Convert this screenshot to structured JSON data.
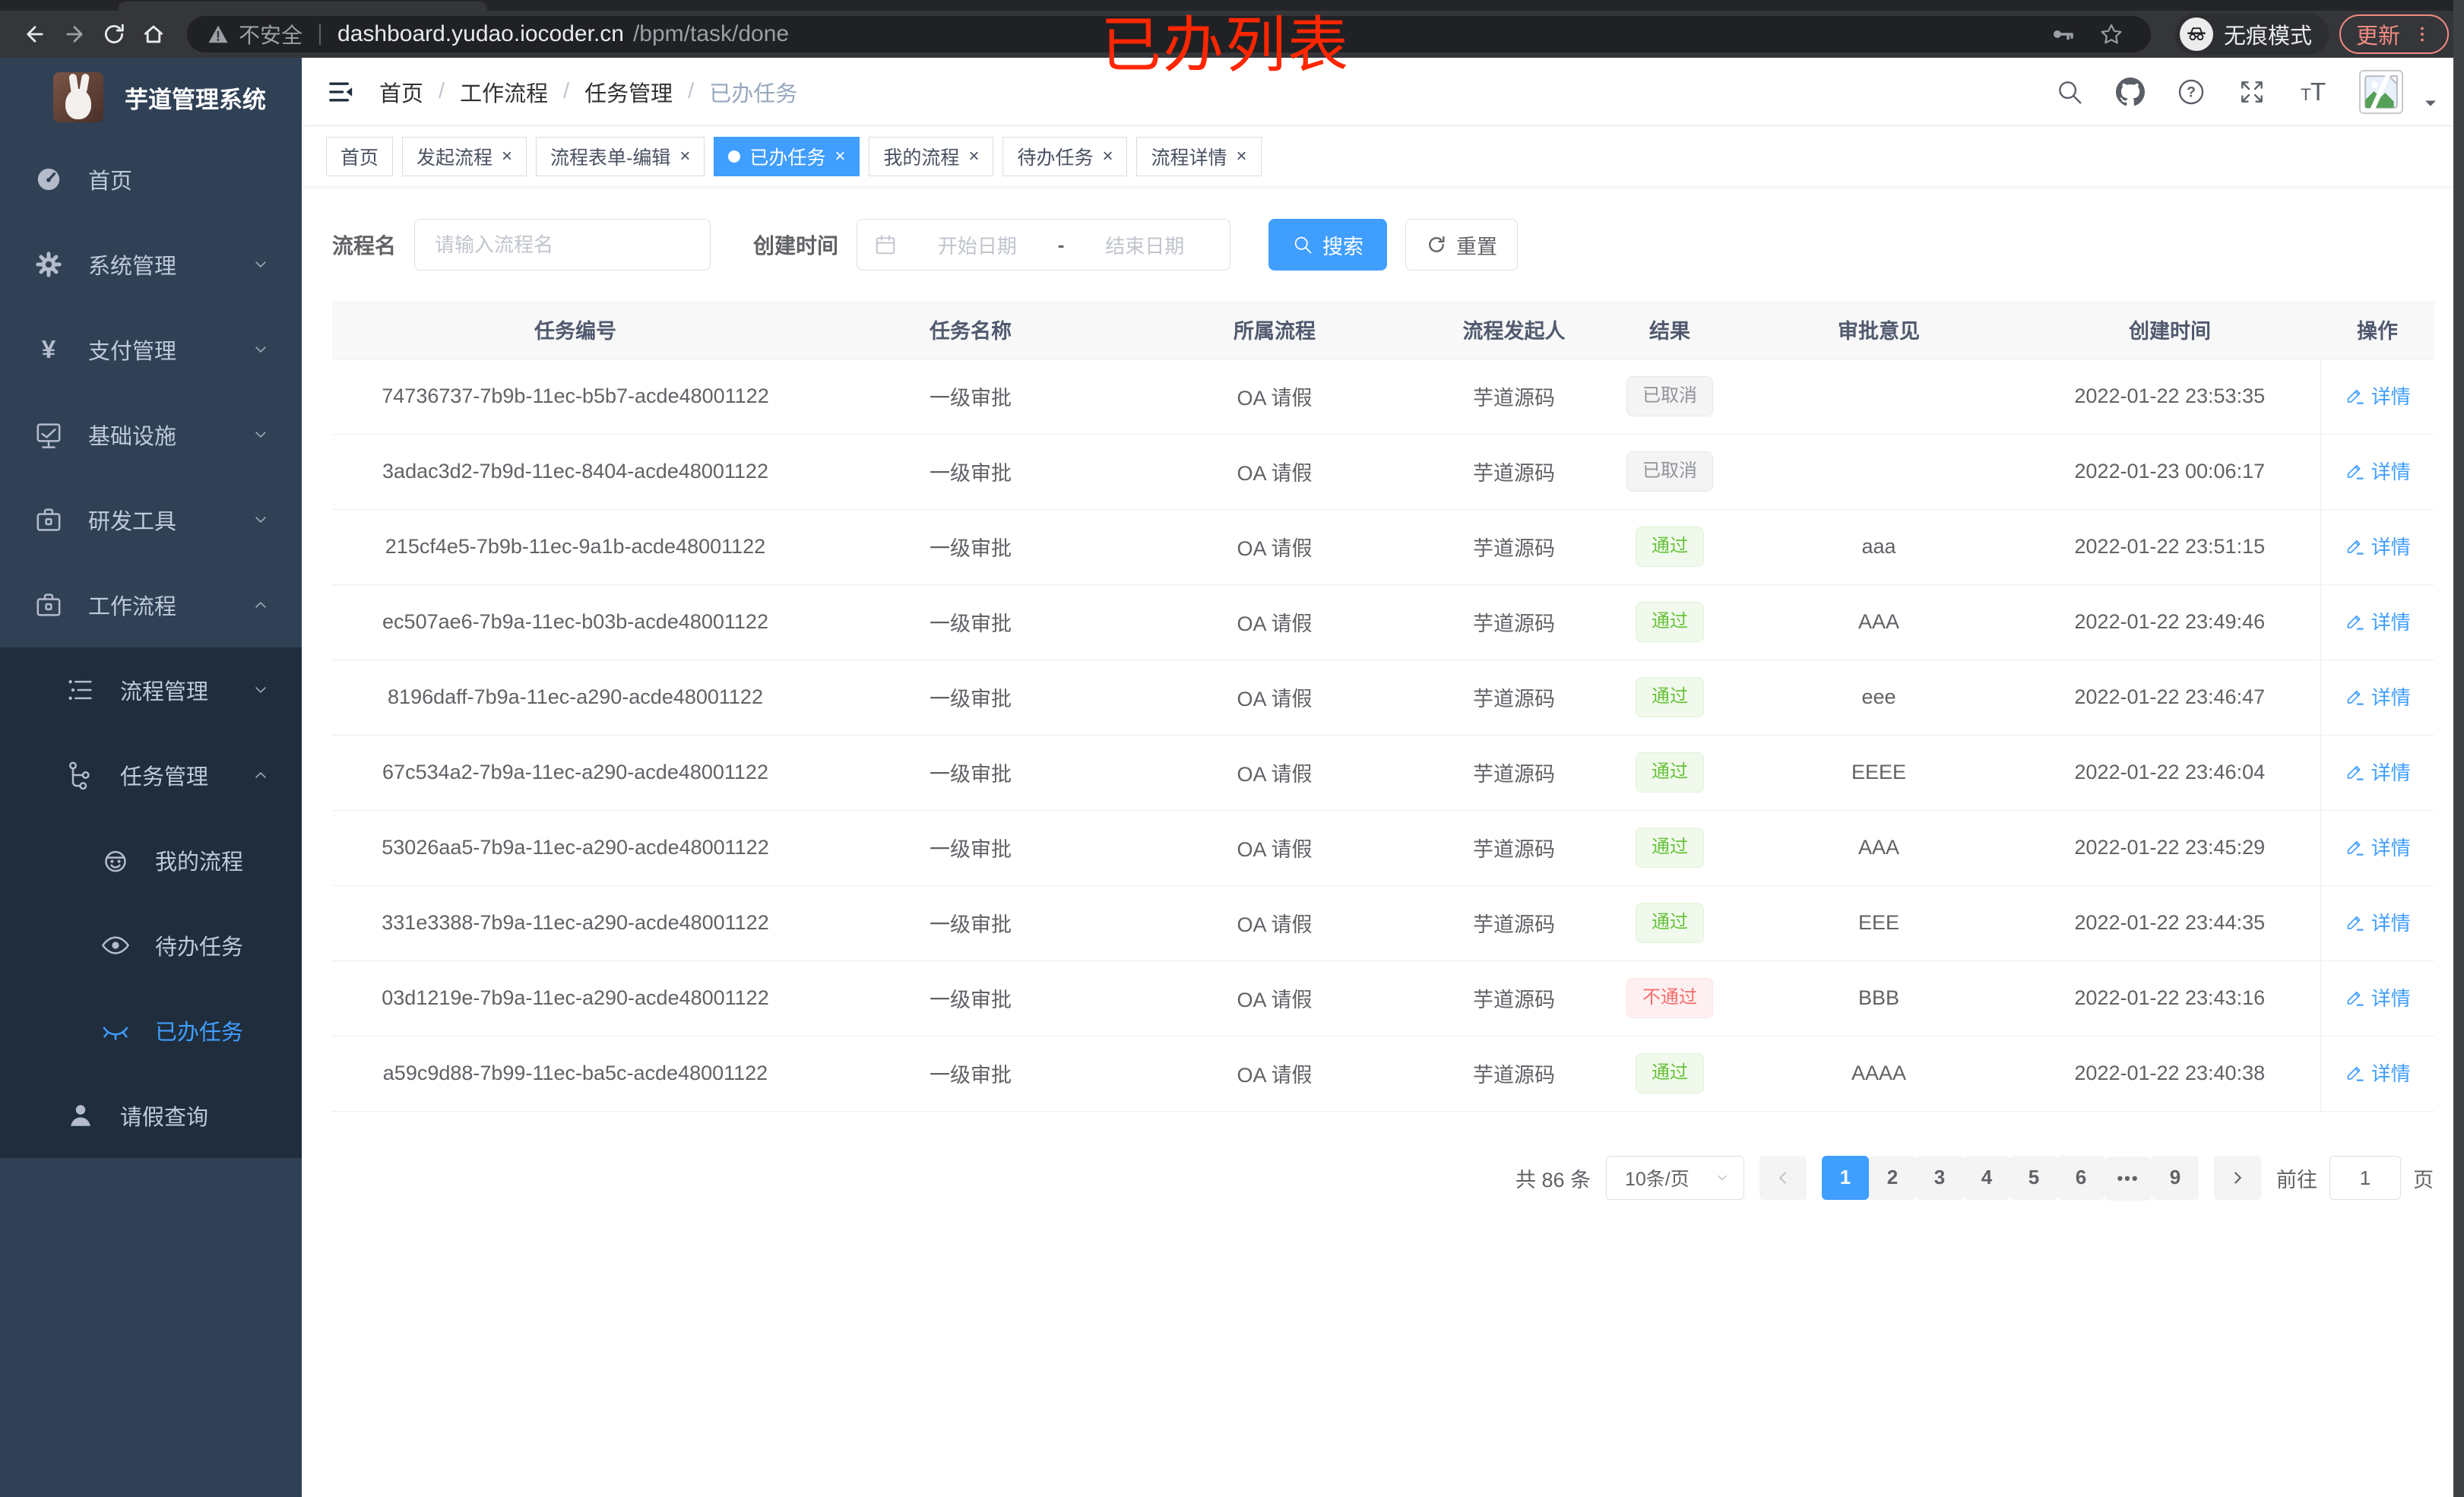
{
  "browser": {
    "security": "不安全",
    "url_host": "dashboard.yudao.iocoder.cn",
    "url_path": "/bpm/task/done",
    "incognito_label": "无痕模式",
    "update_label": "更新"
  },
  "annotation": {
    "text": "已办列表",
    "color": "#ff2600"
  },
  "sidebar": {
    "title": "芋道管理系统",
    "items": [
      {
        "label": "首页",
        "icon": "dashboard",
        "cls": "lv1",
        "chevron": ""
      },
      {
        "label": "系统管理",
        "icon": "gear",
        "cls": "lv1",
        "chevron": "down"
      },
      {
        "label": "支付管理",
        "icon": "yen",
        "cls": "lv1",
        "chevron": "down"
      },
      {
        "label": "基础设施",
        "icon": "infra",
        "cls": "lv1",
        "chevron": "down"
      },
      {
        "label": "研发工具",
        "icon": "briefcase",
        "cls": "lv1",
        "chevron": "down"
      },
      {
        "label": "工作流程",
        "icon": "briefcase",
        "cls": "lv1",
        "chevron": "up"
      },
      {
        "label": "流程管理",
        "icon": "tree-list",
        "cls": "lv2 sub",
        "chevron": "down"
      },
      {
        "label": "任务管理",
        "icon": "flow-nodes",
        "cls": "lv2 sub",
        "chevron": "up"
      },
      {
        "label": "我的流程",
        "icon": "robot",
        "cls": "lv3 sub",
        "chevron": ""
      },
      {
        "label": "待办任务",
        "icon": "eye-open",
        "cls": "lv3 sub",
        "chevron": ""
      },
      {
        "label": "已办任务",
        "icon": "eye-closed",
        "cls": "lv3 sub active",
        "chevron": ""
      },
      {
        "label": "请假查询",
        "icon": "user",
        "cls": "lv2 sub",
        "chevron": ""
      }
    ]
  },
  "header": {
    "breadcrumb": [
      {
        "label": "首页",
        "sep": "/"
      },
      {
        "label": "工作流程",
        "sep": "/"
      },
      {
        "label": "任务管理",
        "sep": "/"
      },
      {
        "label": "已办任务",
        "cls": "last"
      }
    ]
  },
  "tagsview": {
    "tabs": [
      {
        "label": "首页"
      },
      {
        "label": "发起流程",
        "closable": true
      },
      {
        "label": "流程表单-编辑",
        "closable": true
      },
      {
        "label": "已办任务",
        "closable": true,
        "cls": "active"
      },
      {
        "label": "我的流程",
        "closable": true
      },
      {
        "label": "待办任务",
        "closable": true
      },
      {
        "label": "流程详情",
        "closable": true
      }
    ]
  },
  "filters": {
    "name_label": "流程名",
    "name_placeholder": "请输入流程名",
    "time_label": "创建时间",
    "start_placeholder": "开始日期",
    "range_separator": "-",
    "end_placeholder": "结束日期",
    "search_label": "搜索",
    "reset_label": "重置"
  },
  "table": {
    "headers": [
      {
        "label": "任务编号"
      },
      {
        "label": "任务名称"
      },
      {
        "label": "所属流程"
      },
      {
        "label": "流程发起人"
      },
      {
        "label": "结果"
      },
      {
        "label": "审批意见"
      },
      {
        "label": "创建时间"
      },
      {
        "label": "操作"
      }
    ],
    "action_label": "详情",
    "rows": [
      {
        "id": "74736737-7b9b-11ec-b5b7-acde48001122",
        "name": "一级审批",
        "process": "OA 请假",
        "starter": "芋道源码",
        "result": "已取消",
        "resultCls": "tag-info",
        "comment": "",
        "created": "2022-01-22 23:53:35"
      },
      {
        "id": "3adac3d2-7b9d-11ec-8404-acde48001122",
        "name": "一级审批",
        "process": "OA 请假",
        "starter": "芋道源码",
        "result": "已取消",
        "resultCls": "tag-info",
        "comment": "",
        "created": "2022-01-23 00:06:17"
      },
      {
        "id": "215cf4e5-7b9b-11ec-9a1b-acde48001122",
        "name": "一级审批",
        "process": "OA 请假",
        "starter": "芋道源码",
        "result": "通过",
        "resultCls": "tag-success",
        "comment": "aaa",
        "created": "2022-01-22 23:51:15"
      },
      {
        "id": "ec507ae6-7b9a-11ec-b03b-acde48001122",
        "name": "一级审批",
        "process": "OA 请假",
        "starter": "芋道源码",
        "result": "通过",
        "resultCls": "tag-success",
        "comment": "AAA",
        "created": "2022-01-22 23:49:46"
      },
      {
        "id": "8196daff-7b9a-11ec-a290-acde48001122",
        "name": "一级审批",
        "process": "OA 请假",
        "starter": "芋道源码",
        "result": "通过",
        "resultCls": "tag-success",
        "comment": "eee",
        "created": "2022-01-22 23:46:47"
      },
      {
        "id": "67c534a2-7b9a-11ec-a290-acde48001122",
        "name": "一级审批",
        "process": "OA 请假",
        "starter": "芋道源码",
        "result": "通过",
        "resultCls": "tag-success",
        "comment": "EEEE",
        "created": "2022-01-22 23:46:04"
      },
      {
        "id": "53026aa5-7b9a-11ec-a290-acde48001122",
        "name": "一级审批",
        "process": "OA 请假",
        "starter": "芋道源码",
        "result": "通过",
        "resultCls": "tag-success",
        "comment": "AAA",
        "created": "2022-01-22 23:45:29"
      },
      {
        "id": "331e3388-7b9a-11ec-a290-acde48001122",
        "name": "一级审批",
        "process": "OA 请假",
        "starter": "芋道源码",
        "result": "通过",
        "resultCls": "tag-success",
        "comment": "EEE",
        "created": "2022-01-22 23:44:35"
      },
      {
        "id": "03d1219e-7b9a-11ec-a290-acde48001122",
        "name": "一级审批",
        "process": "OA 请假",
        "starter": "芋道源码",
        "result": "不通过",
        "resultCls": "tag-danger",
        "comment": "BBB",
        "created": "2022-01-22 23:43:16"
      },
      {
        "id": "a59c9d88-7b99-11ec-ba5c-acde48001122",
        "name": "一级审批",
        "process": "OA 请假",
        "starter": "芋道源码",
        "result": "通过",
        "resultCls": "tag-success",
        "comment": "AAAA",
        "created": "2022-01-22 23:40:38"
      }
    ]
  },
  "pagination": {
    "total": "共 86 条",
    "page_size": "10条/页",
    "pages": [
      {
        "label": "1",
        "cls": "active"
      },
      {
        "label": "2"
      },
      {
        "label": "3"
      },
      {
        "label": "4"
      },
      {
        "label": "5"
      },
      {
        "label": "6"
      },
      {
        "label": "•••",
        "cls": "more"
      },
      {
        "label": "9"
      }
    ],
    "go_label": "前往",
    "go_value": "1",
    "go_unit": "页"
  }
}
